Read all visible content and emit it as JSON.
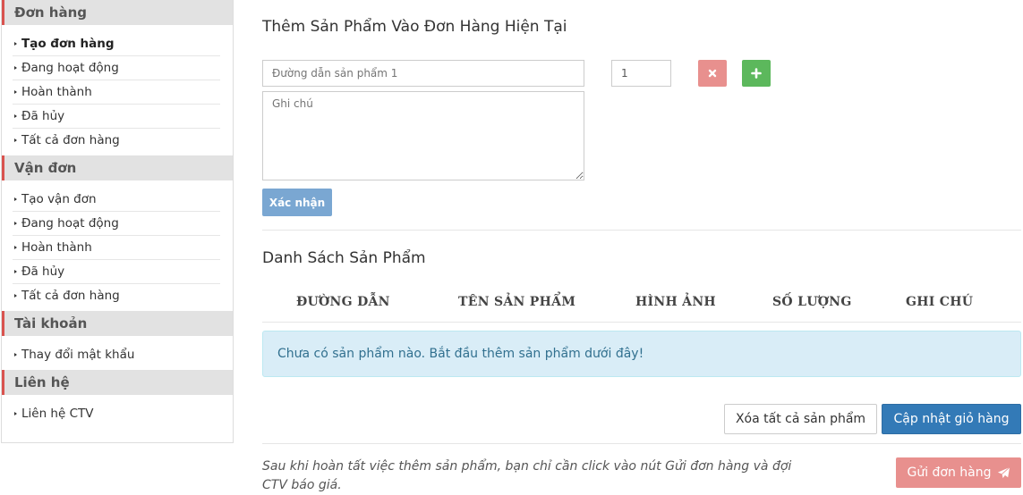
{
  "sidebar": {
    "sections": [
      {
        "title": "Đơn hàng",
        "items": [
          "Tạo đơn hàng",
          "Đang hoạt động",
          "Hoàn thành",
          "Đã hủy",
          "Tất cả đơn hàng"
        ],
        "active": 0
      },
      {
        "title": "Vận đơn",
        "items": [
          "Tạo vận đơn",
          "Đang hoạt động",
          "Hoàn thành",
          "Đã hủy",
          "Tất cả đơn hàng"
        ]
      },
      {
        "title": "Tài khoản",
        "items": [
          "Thay đổi mật khẩu"
        ]
      },
      {
        "title": "Liên hệ",
        "items": [
          "Liên hệ CTV"
        ]
      }
    ]
  },
  "add_form": {
    "heading": "Thêm Sản Phẩm Vào Đơn Hàng Hiện Tại",
    "link_placeholder": "Đường dẫn sản phẩm 1",
    "quantity_value": "1",
    "note_placeholder": "Ghi chú",
    "remove_icon": "times-icon",
    "add_icon": "plus-icon",
    "confirm_label": "Xác nhận"
  },
  "product_list": {
    "heading": "Danh Sách Sản Phẩm",
    "columns": [
      "ĐƯỜNG DẪN",
      "TÊN SẢN PHẨM",
      "HÌNH ẢNH",
      "SỐ LƯỢNG",
      "GHI CHÚ"
    ],
    "empty_message": "Chưa có sản phẩm nào. Bắt đầu thêm sản phẩm dưới đây!",
    "clear_all_label": "Xóa tất cả sản phẩm",
    "update_cart_label": "Cập nhật giỏ hàng"
  },
  "footer": {
    "note": "Sau khi hoàn tất việc thêm sản phẩm, bạn chỉ cần click vào nút Gửi đơn hàng và đợi CTV báo giá.",
    "submit_label": "Gửi đơn hàng",
    "submit_icon": "paper-plane-icon"
  },
  "colors": {
    "accent_red": "#d9534f",
    "primary_blue": "#337ab7",
    "success_green": "#5cb85c",
    "info_bg": "#d9edf7"
  }
}
